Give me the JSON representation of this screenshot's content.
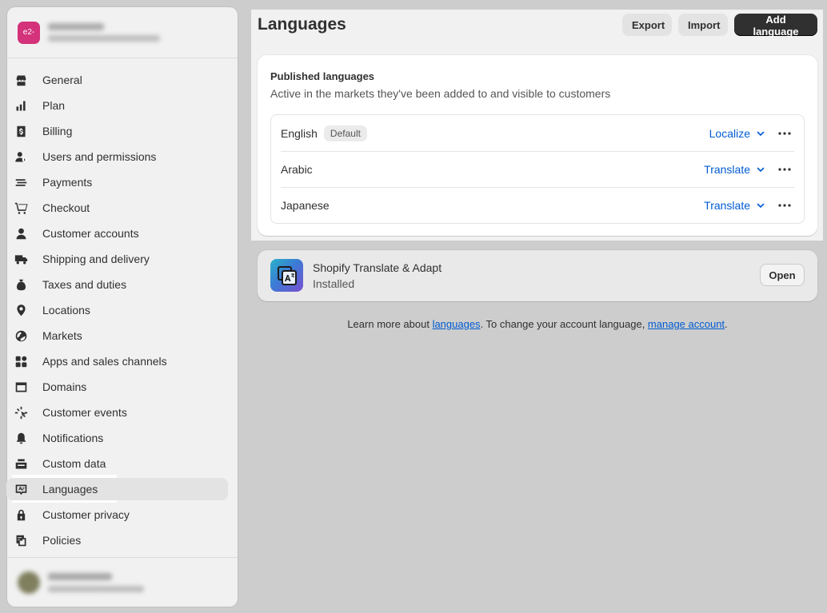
{
  "store": {
    "avatar_text": "e2-"
  },
  "sidebar": {
    "items": [
      {
        "label": "General",
        "icon": "store-icon"
      },
      {
        "label": "Plan",
        "icon": "plan-icon"
      },
      {
        "label": "Billing",
        "icon": "billing-icon"
      },
      {
        "label": "Users and permissions",
        "icon": "users-icon"
      },
      {
        "label": "Payments",
        "icon": "payments-icon"
      },
      {
        "label": "Checkout",
        "icon": "cart-icon"
      },
      {
        "label": "Customer accounts",
        "icon": "person-icon"
      },
      {
        "label": "Shipping and delivery",
        "icon": "truck-icon"
      },
      {
        "label": "Taxes and duties",
        "icon": "tax-icon"
      },
      {
        "label": "Locations",
        "icon": "location-icon"
      },
      {
        "label": "Markets",
        "icon": "globe-icon"
      },
      {
        "label": "Apps and sales channels",
        "icon": "apps-icon"
      },
      {
        "label": "Domains",
        "icon": "domain-icon"
      },
      {
        "label": "Customer events",
        "icon": "events-icon"
      },
      {
        "label": "Notifications",
        "icon": "bell-icon"
      },
      {
        "label": "Custom data",
        "icon": "database-icon"
      },
      {
        "label": "Languages",
        "icon": "language-icon",
        "active": true
      },
      {
        "label": "Customer privacy",
        "icon": "lock-icon"
      },
      {
        "label": "Policies",
        "icon": "policy-icon"
      }
    ]
  },
  "header": {
    "title": "Languages",
    "export_label": "Export",
    "import_label": "Import",
    "add_label": "Add language"
  },
  "published": {
    "title": "Published languages",
    "subtitle": "Active in the markets they've been added to and visible to customers",
    "languages": [
      {
        "name": "English",
        "badge": "Default",
        "action": "Localize"
      },
      {
        "name": "Arabic",
        "action": "Translate"
      },
      {
        "name": "Japanese",
        "action": "Translate"
      }
    ]
  },
  "app": {
    "name": "Shopify Translate & Adapt",
    "status": "Installed",
    "open_label": "Open"
  },
  "help": {
    "prefix": "Learn more about ",
    "link1": "languages",
    "middle": ". To change your account language, ",
    "link2": "manage account",
    "suffix": "."
  },
  "colors": {
    "accent_link": "#005bd3",
    "primary_button": "#303030",
    "store_avatar": "#d4327a"
  }
}
